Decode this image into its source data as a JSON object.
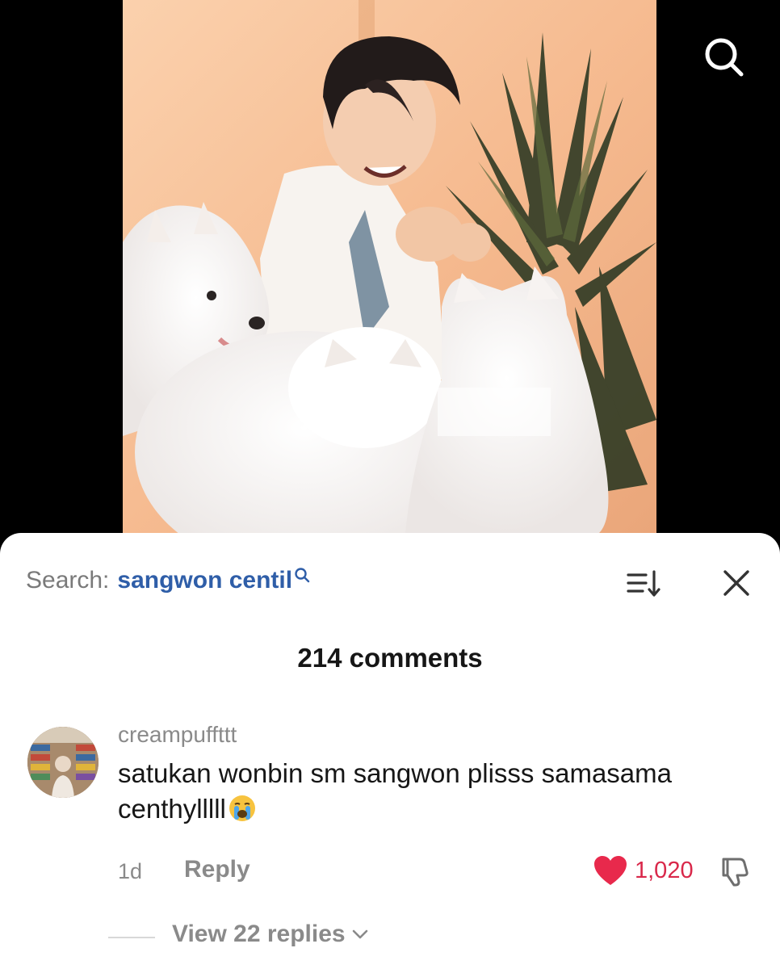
{
  "video": {
    "search_icon": "search-icon"
  },
  "comments_sheet": {
    "search_label": "Search:",
    "search_query": "sangwon centil",
    "sort_icon": "sort-icon",
    "close_icon": "close-icon",
    "count_text": "214 comments"
  },
  "comment": {
    "username": "creampuffttt",
    "text": "satukan wonbin sm sangwon plisss samasama centhylllll",
    "emoji": "crying-face-emoji",
    "time": "1d",
    "reply_label": "Reply",
    "likes": "1,020",
    "view_replies": "View 22 replies"
  },
  "colors": {
    "accent_link": "#2f5ea8",
    "like_red": "#d9284a",
    "muted_text": "#8a8a8a"
  }
}
